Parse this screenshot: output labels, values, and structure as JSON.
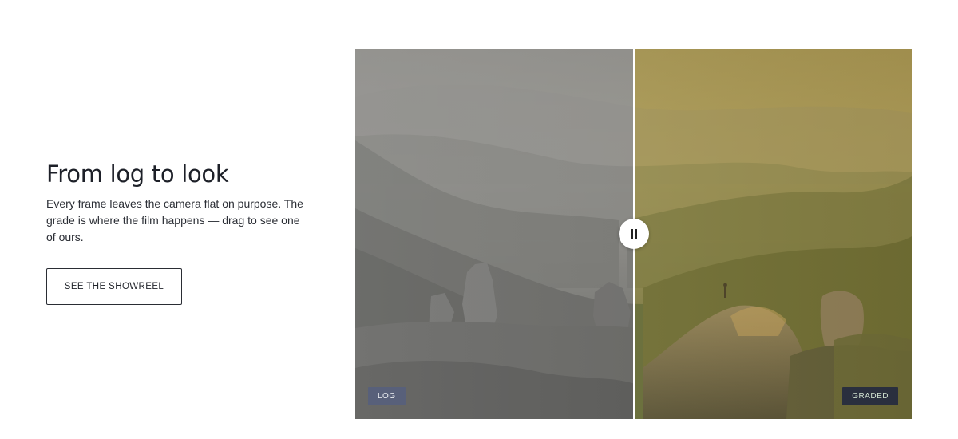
{
  "section": {
    "heading": "From log to look",
    "body": "Every frame leaves the camera flat on purpose. The grade is where the film happens — drag to see one of ours.",
    "cta_label": "SEE THE SHOWREEL"
  },
  "comparison": {
    "before_label": "LOG",
    "after_label": "GRADED",
    "split_position": 0.5,
    "handle_icon": "pause-bars-icon",
    "before_style": "desaturated-grey",
    "after_style": "warm-golden"
  },
  "colors": {
    "text": "#1d2028",
    "divider": "#ffffff",
    "log_tag_bg": "#58607a",
    "graded_tag_bg": "#2a2f3e"
  }
}
